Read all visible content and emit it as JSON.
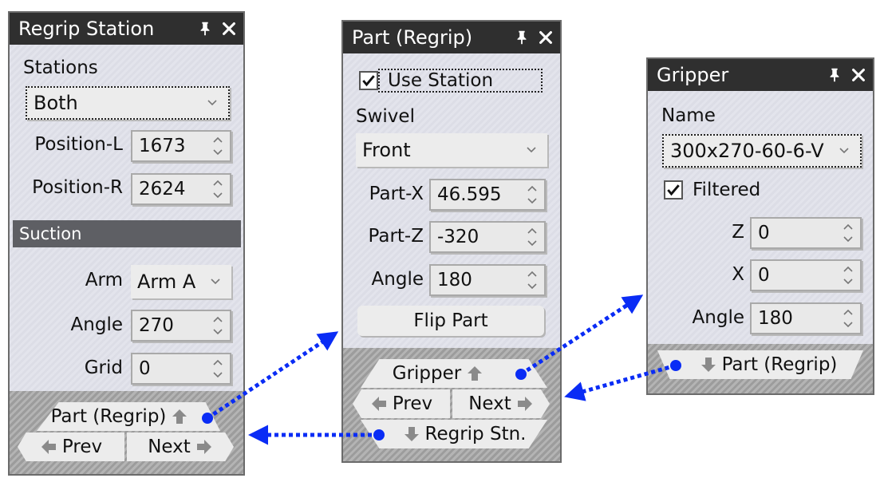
{
  "colors": {
    "link_arrow": "#0a2cf5",
    "titlebar": "#2f2f2f",
    "section_header": "#5e5f64"
  },
  "panels": {
    "regrip_station": {
      "title": "Regrip Station",
      "title_icons": [
        "pin-icon",
        "close-icon"
      ],
      "stations_label": "Stations",
      "stations_value": "Both",
      "position_l_label": "Position-L",
      "position_l_value": "1673",
      "position_r_label": "Position-R",
      "position_r_value": "2624",
      "section_title": "Suction",
      "arm_label": "Arm",
      "arm_value": "Arm A",
      "angle_label": "Angle",
      "angle_value": "270",
      "grid_label": "Grid",
      "grid_value": "0",
      "nav_up_label": "Part (Regrip)",
      "nav_prev_label": "Prev",
      "nav_next_label": "Next"
    },
    "part_regrip": {
      "title": "Part (Regrip)",
      "title_icons": [
        "pin-icon",
        "close-icon"
      ],
      "use_station_label": "Use Station",
      "use_station_checked": true,
      "swivel_label": "Swivel",
      "swivel_value": "Front",
      "part_x_label": "Part-X",
      "part_x_value": "46.595",
      "part_z_label": "Part-Z",
      "part_z_value": "-320",
      "angle_label": "Angle",
      "angle_value": "180",
      "flip_button_label": "Flip Part",
      "nav_up_label": "Gripper",
      "nav_prev_label": "Prev",
      "nav_next_label": "Next",
      "nav_down_label": "Regrip Stn."
    },
    "gripper": {
      "title": "Gripper",
      "title_icons": [
        "pin-icon",
        "close-icon"
      ],
      "name_label": "Name",
      "name_value": "300x270-60-6-V",
      "filtered_label": "Filtered",
      "filtered_checked": true,
      "z_label": "Z",
      "z_value": "0",
      "x_label": "X",
      "x_value": "0",
      "angle_label": "Angle",
      "angle_value": "180",
      "nav_down_label": "Part (Regrip)"
    }
  }
}
